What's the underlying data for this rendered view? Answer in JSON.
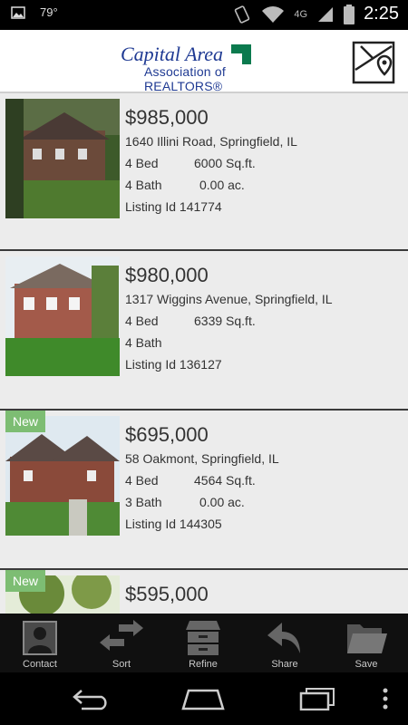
{
  "status_bar": {
    "temperature": "79°",
    "network": "4G",
    "time": "2:25"
  },
  "header": {
    "logo_line1": "Capital Area",
    "logo_line2": "Association of REALTORS®"
  },
  "listings": [
    {
      "price": "$985,000",
      "address": "1640 Illini Road, Springfield, IL",
      "beds": "4 Bed",
      "sqft": "6000 Sq.ft.",
      "baths": "4 Bath",
      "acres": "0.00 ac.",
      "listing_id": "Listing Id 141774",
      "badge": ""
    },
    {
      "price": "$980,000",
      "address": "1317 Wiggins Avenue, Springfield, IL",
      "beds": "4 Bed",
      "sqft": "6339 Sq.ft.",
      "baths": "4 Bath",
      "acres": "",
      "listing_id": "Listing Id 136127",
      "badge": ""
    },
    {
      "price": "$695,000",
      "address": "58 Oakmont, Springfield, IL",
      "beds": "4 Bed",
      "sqft": "4564 Sq.ft.",
      "baths": "3 Bath",
      "acres": "0.00 ac.",
      "listing_id": "Listing Id 144305",
      "badge": "New"
    },
    {
      "price": "$595,000",
      "badge": "New"
    }
  ],
  "toolbar": {
    "contact": "Contact",
    "sort": "Sort",
    "refine": "Refine",
    "share": "Share",
    "save": "Save"
  },
  "colors": {
    "brand_blue": "#1f3a93",
    "brand_green": "#0b7a4e",
    "badge_green": "#7dbd73"
  }
}
